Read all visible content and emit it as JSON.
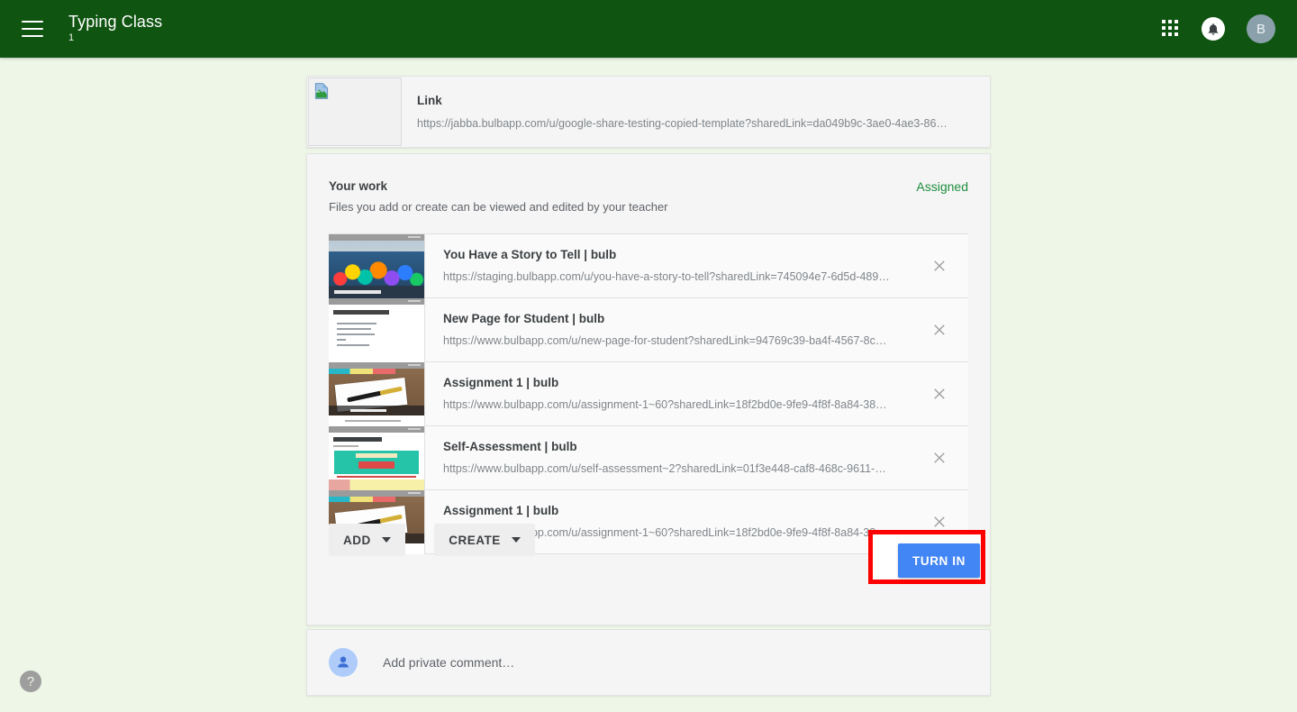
{
  "header": {
    "menu_icon": "hamburger-menu-icon",
    "class_title": "Typing Class",
    "class_section": "1",
    "apps_icon": "apps-grid-icon",
    "notifications_icon": "bell-icon",
    "avatar_initial": "B",
    "background_color": "#0f5411"
  },
  "link_card": {
    "thumbnail_icon": "broken-image-icon",
    "title": "Link",
    "url": "https://jabba.bulbapp.com/u/google-share-testing-copied-template?sharedLink=da049b9c-3ae0-4ae3-86…"
  },
  "your_work": {
    "heading": "Your work",
    "subheading": "Files you add or create can be viewed and edited by your teacher",
    "status": "Assigned",
    "status_color": "#1e8e3e",
    "attachments": [
      {
        "title": "You Have a Story to Tell | bulb",
        "url": "https://staging.bulbapp.com/u/you-have-a-story-to-tell?sharedLink=745094e7-6d5d-489…",
        "thumbnail": "colorful-crowd-photo-thumbnail",
        "remove_icon": "close-x-icon"
      },
      {
        "title": "New Page for Student | bulb",
        "url": "https://www.bulbapp.com/u/new-page-for-student?sharedLink=94769c39-ba4f-4567-8c…",
        "thumbnail": "white-document-page-thumbnail",
        "remove_icon": "close-x-icon"
      },
      {
        "title": "Assignment 1 | bulb",
        "url": "https://www.bulbapp.com/u/assignment-1~60?sharedLink=18f2bd0e-9fe9-4f8f-8a84-38…",
        "thumbnail": "notebook-and-pen-photo-thumbnail",
        "remove_icon": "close-x-icon"
      },
      {
        "title": "Self-Assessment | bulb",
        "url": "https://www.bulbapp.com/u/self-assessment~2?sharedLink=01f3e448-caf8-468c-9611-…",
        "thumbnail": "teal-banner-value-thumbnail",
        "remove_icon": "close-x-icon"
      },
      {
        "title": "Assignment 1 | bulb",
        "url": "https://www.bulbapp.com/u/assignment-1~60?sharedLink=18f2bd0e-9fe9-4f8f-8a84-38…",
        "thumbnail": "notebook-and-pen-photo-thumbnail",
        "remove_icon": "close-x-icon"
      }
    ],
    "add_button": "ADD",
    "create_button": "CREATE",
    "turn_in_button": "TURN IN",
    "turn_in_color": "#4285f4",
    "highlight_color": "#ff0000"
  },
  "comment": {
    "avatar_icon": "person-avatar-icon",
    "placeholder": "Add private comment…"
  },
  "help": {
    "label": "?",
    "icon": "help-question-icon"
  }
}
